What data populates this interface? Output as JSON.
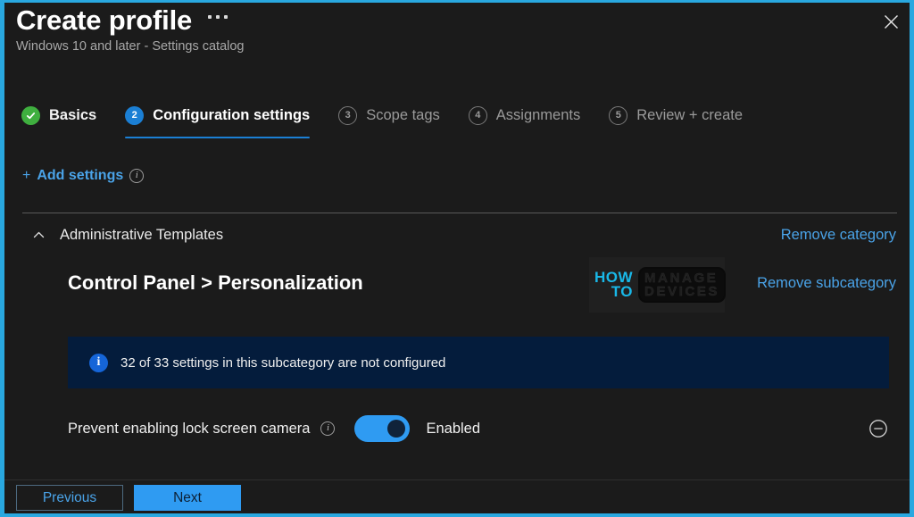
{
  "window": {
    "title": "Create profile",
    "subtitle": "Windows 10 and later - Settings catalog",
    "more_menu": "more-options",
    "close_label": "Close"
  },
  "tabs": [
    {
      "marker": "✓",
      "label": "Basics",
      "state": "done"
    },
    {
      "marker": "2",
      "label": "Configuration settings",
      "state": "active"
    },
    {
      "marker": "3",
      "label": "Scope tags",
      "state": "idle"
    },
    {
      "marker": "4",
      "label": "Assignments",
      "state": "idle"
    },
    {
      "marker": "5",
      "label": "Review + create",
      "state": "idle"
    }
  ],
  "toolbar": {
    "add_settings_plus": "+",
    "add_settings_label": "Add settings",
    "add_settings_info": "i"
  },
  "category": {
    "name": "Administrative Templates",
    "remove_link": "Remove category",
    "collapse_state": "expanded"
  },
  "subcategory": {
    "path_part1": "Control Panel",
    "separator": ">",
    "path_part2": "Personalization",
    "remove_link": "Remove subcategory"
  },
  "watermark": {
    "line1": "HOW",
    "line2": "TO",
    "box_line1": "MANAGE",
    "box_line2": "DEVICES"
  },
  "banner": {
    "icon": "i",
    "text": "32 of 33 settings in this subcategory are not configured"
  },
  "setting": {
    "label": "Prevent enabling lock screen camera",
    "info": "i",
    "toggle_value": "on",
    "state_label": "Enabled",
    "remove_icon": "minus-circle-icon"
  },
  "footer": {
    "previous_label": "Previous",
    "next_label": "Next"
  },
  "colors": {
    "accent_blue": "#2f9bf2",
    "link_blue": "#4aa3e8",
    "frame_cyan": "#29a8e0",
    "tab_active": "#1b7fd4",
    "tab_done_green": "#3faf3f",
    "banner_bg": "#041c3c",
    "page_bg": "#1b1b1b",
    "watermark_cyan": "#19b8e8"
  }
}
